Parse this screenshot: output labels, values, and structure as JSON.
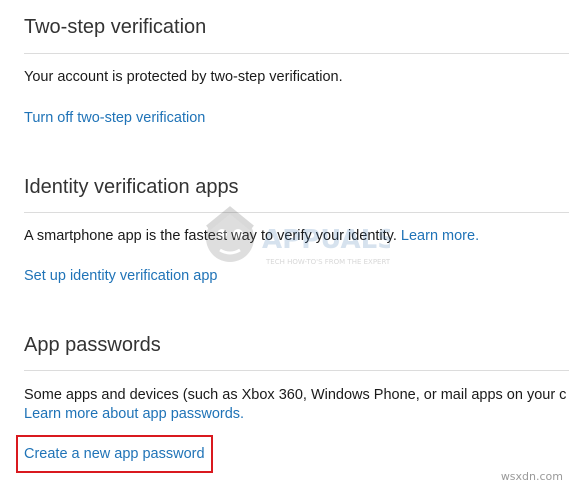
{
  "sections": {
    "two_step": {
      "heading": "Two-step verification",
      "description": "Your account is protected by two-step verification.",
      "link": "Turn off two-step verification"
    },
    "identity_apps": {
      "heading": "Identity verification apps",
      "description": "A smartphone app is the fastest way to verify your identity.",
      "inline_link": "Learn more.",
      "link": "Set up identity verification app"
    },
    "app_passwords": {
      "heading": "App passwords",
      "description": "Some apps and devices (such as Xbox 360, Windows Phone, or mail apps on your c",
      "learn_link": "Learn more about app passwords.",
      "create_link": "Create a new app password"
    }
  },
  "watermark": {
    "brand": "APPUALS",
    "tagline": "TECH HOW-TO'S FROM THE EXPERTS!"
  },
  "footer": {
    "site": "wsxdn.com"
  },
  "colors": {
    "link": "#1f73b7",
    "highlight": "#d9191f",
    "divider": "#dcdcdc"
  }
}
